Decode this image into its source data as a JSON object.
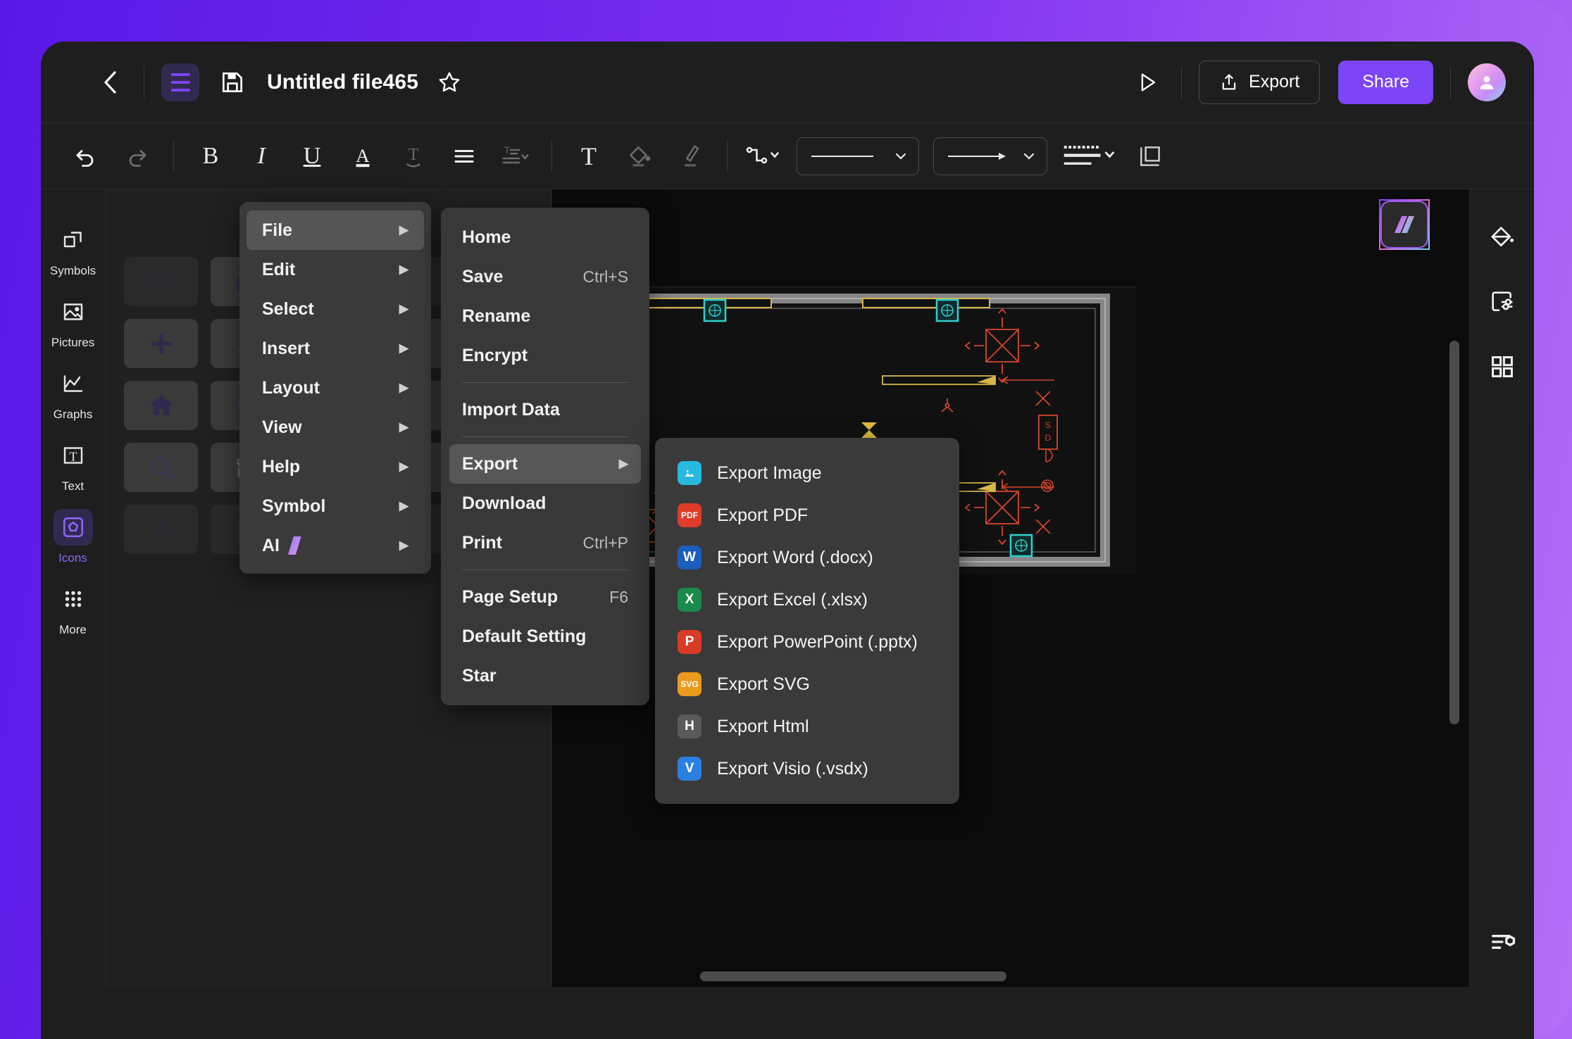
{
  "window": {
    "title": "Untitled file465"
  },
  "header": {
    "back_icon": "chevron-left-icon",
    "menu_icon": "hamburger-menu-icon",
    "save_icon": "floppy-save-icon",
    "star_icon": "star-outline-icon",
    "present_icon": "play-present-icon",
    "export_label": "Export",
    "export_icon": "share-upload-icon",
    "share_label": "Share",
    "share_color": "#7c45f5",
    "avatar_icon": "user-avatar"
  },
  "toolbar": {
    "items": [
      {
        "name": "undo-button",
        "glyph": "undo",
        "dim": false
      },
      {
        "name": "redo-button",
        "glyph": "redo",
        "dim": true
      },
      {
        "name": "bold-button",
        "glyph": "B",
        "dim": false
      },
      {
        "name": "italic-button",
        "glyph": "I",
        "dim": false
      },
      {
        "name": "underline-button",
        "glyph": "U",
        "dim": false
      },
      {
        "name": "font-color-button",
        "glyph": "A",
        "dim": false
      },
      {
        "name": "text-direction-button",
        "glyph": "T",
        "dim": true
      },
      {
        "name": "align-button",
        "glyph": "align",
        "dim": false
      },
      {
        "name": "line-spacing-button",
        "glyph": "spacing",
        "dim": true
      },
      {
        "name": "text-tool-button",
        "glyph": "T",
        "dim": false
      },
      {
        "name": "fill-color-button",
        "glyph": "bucket",
        "dim": true
      },
      {
        "name": "brush-button",
        "glyph": "brush",
        "dim": true
      }
    ],
    "connector_label": "connector-style",
    "line_label": "line-style",
    "arrow_label": "arrow-style",
    "dash_label": "dash-style",
    "layer_label": "layer-order"
  },
  "left_rail": {
    "items": [
      {
        "label": "Symbols",
        "icon": "symbols-icon",
        "active": false
      },
      {
        "label": "Pictures",
        "icon": "pictures-icon",
        "active": false
      },
      {
        "label": "Graphs",
        "icon": "graphs-icon",
        "active": false
      },
      {
        "label": "Text",
        "icon": "text-icon",
        "active": false
      },
      {
        "label": "Icons",
        "icon": "icons-icon",
        "active": true
      },
      {
        "label": "More",
        "icon": "more-dots-icon",
        "active": false
      }
    ]
  },
  "icon_library": {
    "cells": [
      {
        "icon": "easel-icon",
        "faded": true
      },
      {
        "icon": "building-icon",
        "faded": false
      },
      {
        "icon": "card-yen-icon",
        "faded": true
      },
      {
        "icon": "penguin-icon",
        "faded": true
      },
      {
        "icon": "plus-icon",
        "faded": false
      },
      {
        "icon": "check-icon",
        "faded": false
      },
      {
        "icon": "yen-transfer-icon",
        "faded": false
      },
      {
        "icon": "qq-icon",
        "faded": false
      },
      {
        "icon": "home-icon",
        "faded": false
      },
      {
        "icon": "refresh-icon",
        "faded": false
      },
      {
        "icon": "qrcode-icon",
        "faded": false
      },
      {
        "icon": "chevron-right-icon",
        "faded": false
      },
      {
        "icon": "search-icon",
        "faded": false
      },
      {
        "icon": "shop-icon",
        "faded": false
      },
      {
        "icon": "question-icon",
        "faded": false
      },
      {
        "icon": "location-pin-icon",
        "faded": false
      },
      {
        "icon": "compass-icon",
        "faded": true
      },
      {
        "icon": "tape-icon",
        "faded": true
      },
      {
        "icon": "scissors-icon",
        "faded": true
      },
      {
        "icon": "stamp-icon",
        "faded": true
      }
    ]
  },
  "canvas": {
    "ai_badge": "ai-assistant-icon",
    "vertical_scrollbar": "canvas-vscrollbar",
    "horizontal_scrollbar": "canvas-hscrollbar",
    "drawing": "floor-plan-cad-drawing"
  },
  "right_rail": {
    "items": [
      {
        "icon": "paint-bucket-icon",
        "name": "style-panel-button"
      },
      {
        "icon": "page-settings-icon",
        "name": "page-settings-button"
      },
      {
        "icon": "grid-apps-icon",
        "name": "grid-panel-button"
      }
    ],
    "bottom": {
      "icon": "list-settings-icon",
      "name": "options-button"
    }
  },
  "menus": {
    "main": {
      "items": [
        {
          "label": "File",
          "selected": true,
          "has_submenu": true
        },
        {
          "label": "Edit",
          "selected": false,
          "has_submenu": true
        },
        {
          "label": "Select",
          "selected": false,
          "has_submenu": true
        },
        {
          "label": "Insert",
          "selected": false,
          "has_submenu": true
        },
        {
          "label": "Layout",
          "selected": false,
          "has_submenu": true
        },
        {
          "label": "View",
          "selected": false,
          "has_submenu": true
        },
        {
          "label": "Help",
          "selected": false,
          "has_submenu": true
        },
        {
          "label": "Symbol",
          "selected": false,
          "has_submenu": true
        },
        {
          "label": "AI",
          "selected": false,
          "has_submenu": true,
          "badge": "ai-gradient-icon"
        }
      ]
    },
    "file": {
      "items": [
        {
          "label": "Home",
          "shortcut": "",
          "selected": false,
          "has_submenu": false,
          "sep_after": false
        },
        {
          "label": "Save",
          "shortcut": "Ctrl+S",
          "selected": false,
          "has_submenu": false,
          "sep_after": false
        },
        {
          "label": "Rename",
          "shortcut": "",
          "selected": false,
          "has_submenu": false,
          "sep_after": false
        },
        {
          "label": "Encrypt",
          "shortcut": "",
          "selected": false,
          "has_submenu": false,
          "sep_after": true
        },
        {
          "label": "Import Data",
          "shortcut": "",
          "selected": false,
          "has_submenu": false,
          "sep_after": true
        },
        {
          "label": "Export",
          "shortcut": "",
          "selected": true,
          "has_submenu": true,
          "sep_after": false
        },
        {
          "label": "Download",
          "shortcut": "",
          "selected": false,
          "has_submenu": false,
          "sep_after": false
        },
        {
          "label": "Print",
          "shortcut": "Ctrl+P",
          "selected": false,
          "has_submenu": false,
          "sep_after": true
        },
        {
          "label": "Page Setup",
          "shortcut": "F6",
          "selected": false,
          "has_submenu": false,
          "sep_after": false
        },
        {
          "label": "Default Setting",
          "shortcut": "",
          "selected": false,
          "has_submenu": false,
          "sep_after": false
        },
        {
          "label": "Star",
          "shortcut": "",
          "selected": false,
          "has_submenu": false,
          "sep_after": false
        }
      ]
    },
    "export": {
      "items": [
        {
          "label": "Export Image",
          "badge": "IMG",
          "color": "#28b9e0",
          "icon": "image-file-icon"
        },
        {
          "label": "Export PDF",
          "badge": "PDF",
          "color": "#de3c29",
          "icon": "pdf-file-icon"
        },
        {
          "label": "Export Word (.docx)",
          "badge": "W",
          "color": "#1b5ebe",
          "icon": "word-file-icon"
        },
        {
          "label": "Export Excel (.xlsx)",
          "badge": "X",
          "color": "#1a8a4a",
          "icon": "excel-file-icon"
        },
        {
          "label": "Export PowerPoint (.pptx)",
          "badge": "P",
          "color": "#d93b26",
          "icon": "powerpoint-file-icon"
        },
        {
          "label": "Export SVG",
          "badge": "SVG",
          "color": "#eb9a1c",
          "icon": "svg-file-icon"
        },
        {
          "label": "Export Html",
          "badge": "H",
          "color": "#5a5a5a",
          "icon": "html-file-icon"
        },
        {
          "label": "Export Visio (.vsdx)",
          "badge": "V",
          "color": "#2b7fe0",
          "icon": "visio-file-icon"
        }
      ]
    }
  }
}
